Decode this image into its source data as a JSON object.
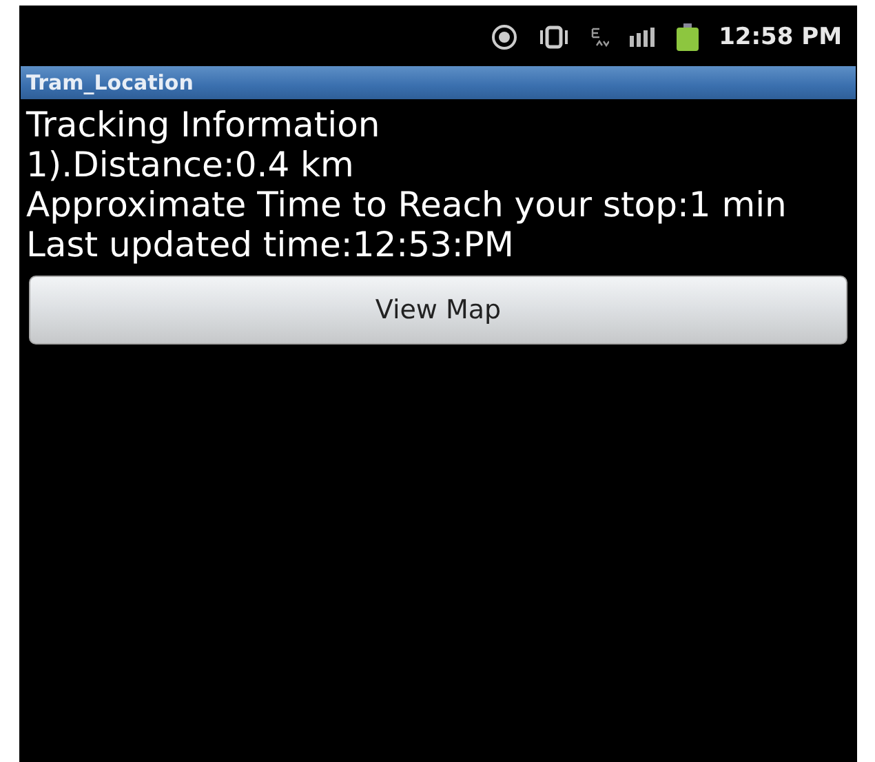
{
  "status_bar": {
    "time": "12:58 PM"
  },
  "title_bar": {
    "title": "Tram_Location"
  },
  "content": {
    "heading": "Tracking Information",
    "lines": [
      "1).Distance:0.4 km",
      "Approximate Time to Reach your stop:1 min",
      "Last updated time:12:53:PM"
    ]
  },
  "buttons": [
    "View Map"
  ]
}
